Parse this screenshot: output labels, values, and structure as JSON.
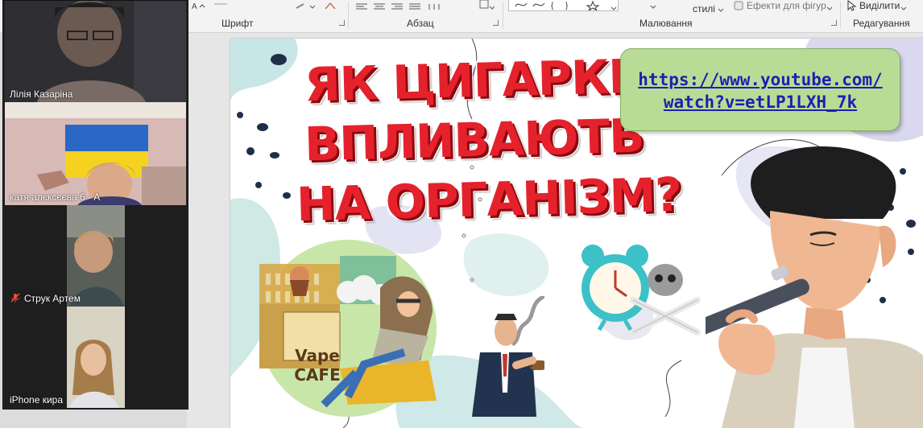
{
  "ribbon": {
    "groups": [
      {
        "label": "Шрифт"
      },
      {
        "label": "Абзац"
      },
      {
        "label": "Малювання"
      },
      {
        "label": "Редагування"
      }
    ],
    "styles_label": "стилі",
    "shape_effects_label": "Ефекти для фігур",
    "select_label": "Виділити"
  },
  "participants": [
    {
      "name": "Лілія Казаріна",
      "active": false
    },
    {
      "name": "катя алєксєєва 6 - А",
      "active": true
    },
    {
      "name": "Струк Артем",
      "muted": true
    },
    {
      "name": "iPhone кира",
      "active": false
    }
  ],
  "slide": {
    "title_lines": [
      "ЯК ЦИГАРКИ",
      "ВПЛИВАЮТЬ",
      "НА ОРГАНІЗМ?"
    ],
    "link_lines": [
      "https://www.youtube.com/",
      "watch?v=etLP1LXH_7k"
    ],
    "cafe_sign_lines": [
      "Vape",
      "CAFE"
    ]
  },
  "colors": {
    "title_red": "#e5222c",
    "link_box_green": "#b8dc96",
    "link_blue": "#1f1fb0",
    "active_speaker": "#2fd27a"
  }
}
